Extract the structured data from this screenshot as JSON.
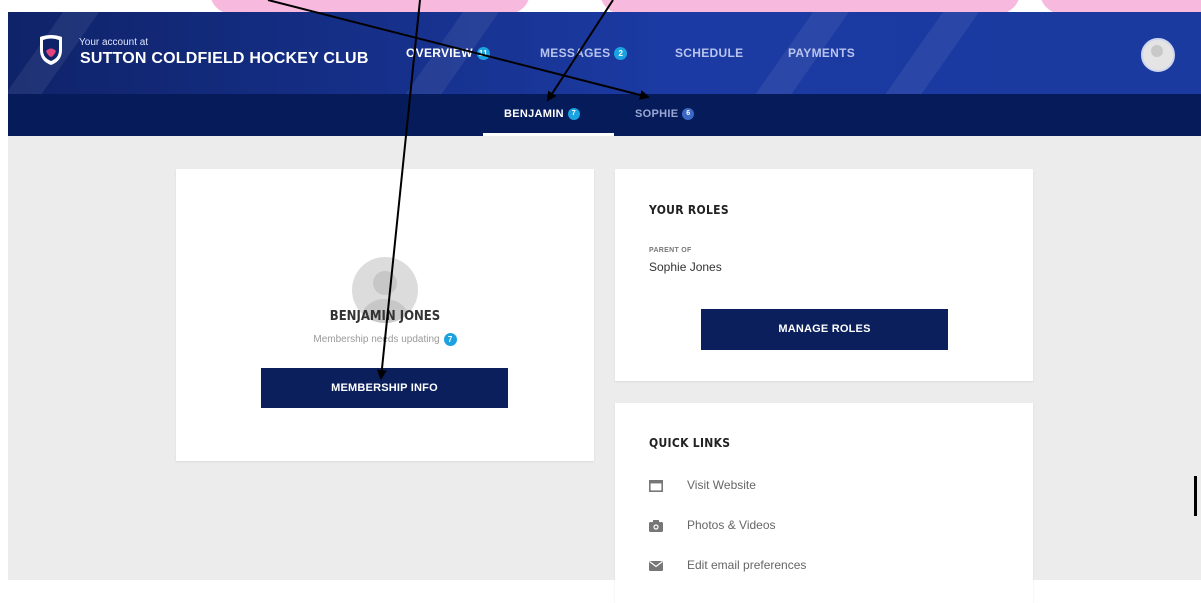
{
  "colors": {
    "header_start": "#0f2369",
    "header_end": "#1b3aa3",
    "subnav": "#061c5a",
    "button": "#0b1f5c",
    "badge": "#1aa3e0",
    "page_bg": "#ececec",
    "annotation_strip": "#f7b9dd"
  },
  "header": {
    "account_prefix": "Your account at",
    "club_name": "SUTTON COLDFIELD HOCKEY CLUB",
    "logo_icon": "shield-logo",
    "avatar_icon": "user-avatar"
  },
  "nav": [
    {
      "label": "OVERVIEW",
      "badge": "11"
    },
    {
      "label": "MESSAGES",
      "badge": "2"
    },
    {
      "label": "SCHEDULE",
      "badge": ""
    },
    {
      "label": "PAYMENTS",
      "badge": ""
    }
  ],
  "subnav": [
    {
      "label": "BENJAMIN",
      "badge": "7",
      "active": true
    },
    {
      "label": "SOPHIE",
      "badge": "6",
      "active": false
    }
  ],
  "profile": {
    "name": "BENJAMIN JONES",
    "status": "Membership needs updating",
    "status_badge": "7",
    "button": "MEMBERSHIP INFO"
  },
  "roles": {
    "title": "YOUR ROLES",
    "label": "PARENT OF",
    "value": "Sophie Jones",
    "button": "MANAGE ROLES"
  },
  "quick_links": {
    "title": "QUICK LINKS",
    "items": [
      {
        "icon": "browser-window-icon",
        "label": "Visit Website"
      },
      {
        "icon": "camera-icon",
        "label": "Photos & Videos"
      },
      {
        "icon": "envelope-icon",
        "label": "Edit email preferences"
      }
    ]
  }
}
